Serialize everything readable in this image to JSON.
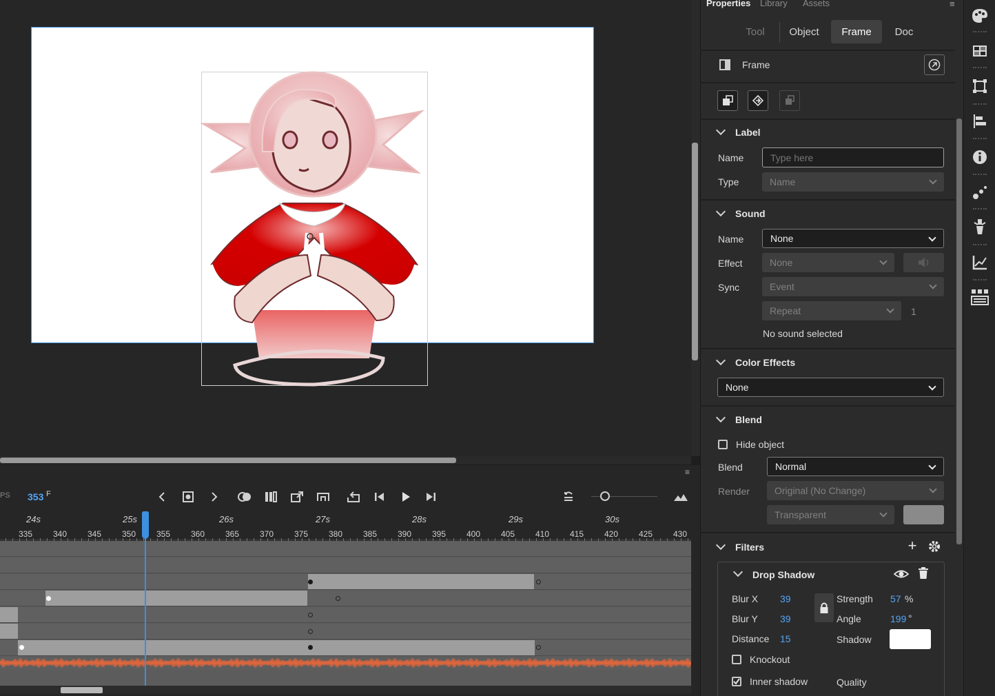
{
  "timeline": {
    "fps_cut": "PS",
    "current_frame": "353",
    "frame_unit": "F",
    "seconds": [
      "24s",
      "25s",
      "26s",
      "27s",
      "28s",
      "29s",
      "30s"
    ],
    "frames": [
      "335",
      "340",
      "345",
      "350",
      "355",
      "360",
      "365",
      "370",
      "375",
      "380",
      "385",
      "390",
      "395",
      "400",
      "405",
      "410",
      "415",
      "420",
      "425",
      "430"
    ]
  },
  "properties": {
    "tabs": [
      "Properties",
      "Library",
      "Assets"
    ],
    "modes": [
      "Tool",
      "Object",
      "Frame",
      "Doc"
    ],
    "header_title": "Frame",
    "label_section": {
      "title": "Label",
      "name_label": "Name",
      "name_placeholder": "Type here",
      "type_label": "Type",
      "type_value": "Name"
    },
    "sound_section": {
      "title": "Sound",
      "name_label": "Name",
      "name_value": "None",
      "effect_label": "Effect",
      "effect_value": "None",
      "sync_label": "Sync",
      "sync_value": "Event",
      "repeat_value": "Repeat",
      "repeat_count": "1",
      "status": "No sound selected"
    },
    "color_effects": {
      "title": "Color Effects",
      "value": "None"
    },
    "blend_section": {
      "title": "Blend",
      "hide_object": "Hide object",
      "blend_label": "Blend",
      "blend_value": "Normal",
      "render_label": "Render",
      "render_value": "Original (No Change)",
      "background_value": "Transparent"
    },
    "filters": {
      "title": "Filters",
      "drop_shadow": {
        "title": "Drop Shadow",
        "blur_x_label": "Blur X",
        "blur_x": "39",
        "blur_y_label": "Blur Y",
        "blur_y": "39",
        "distance_label": "Distance",
        "distance": "15",
        "strength_label": "Strength",
        "strength": "57",
        "strength_unit": "%",
        "angle_label": "Angle",
        "angle": "199",
        "angle_unit": "°",
        "shadow_label": "Shadow",
        "shadow_color": "#ffffff",
        "knockout": "Knockout",
        "inner_shadow": "Inner shadow",
        "quality_label": "Quality"
      }
    }
  },
  "colors": {
    "accent": "#3d8fe0",
    "value_blue": "#56a4f5",
    "panel_bg": "#2b2b2b",
    "stage_bg": "#ffffff"
  },
  "icons": {
    "toolstrip": [
      "palette-icon",
      "swatches-icon",
      "transform-icon",
      "align-icon",
      "info-icon",
      "motion-presets-icon",
      "brush-library-icon",
      "graph-icon",
      "components-icon"
    ]
  }
}
